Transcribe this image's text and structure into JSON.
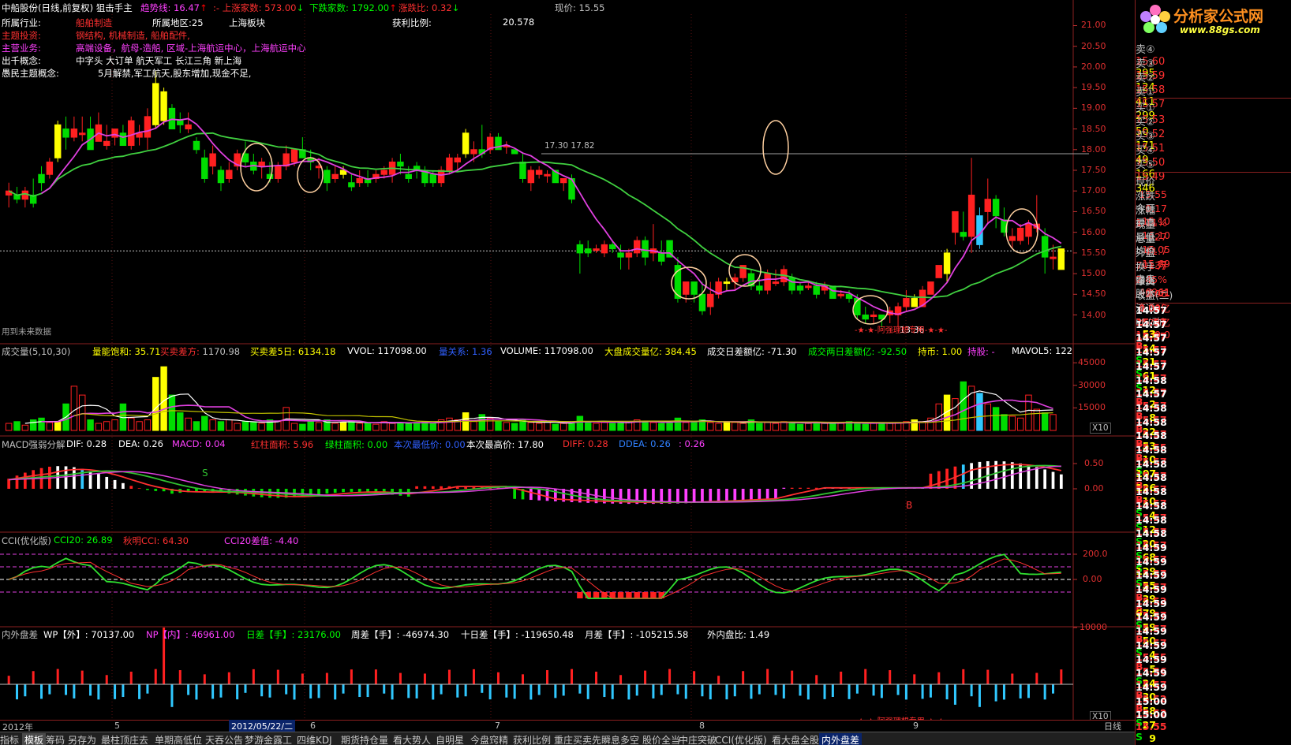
{
  "header": {
    "stock": "中船股份(日线,前复权) 狙击手主",
    "trend_label": "趋势线:",
    "trend_val": "16.47",
    "trend_arrow": "↑",
    "dash": ":-",
    "up_label": "上涨家数:",
    "up_val": "573.00",
    "up_arrow": "↓",
    "down_label": "下跌家数:",
    "down_val": "1792.00",
    "down_arrow": "↑",
    "ratio_label": "涨跌比:",
    "ratio_val": "0.32",
    "ratio_arrow": "↓",
    "price_label": "现价:",
    "price_val": "15.55"
  },
  "info": {
    "industry_label": "所属行业:",
    "industry": "船舶制造",
    "region_label": "所属地区:25",
    "sector": "上海板块",
    "theme_label": "主题投资:",
    "theme": "钢结构, 机械制造, 船舶配件,",
    "business_label": "主营业务:",
    "business": "高端设备，航母-造船, 区域-上海航运中心，上海航运中心",
    "concept_label": "出千概念:",
    "concept": "中字头 大订单 航天军工 长江三角 新上海",
    "folk_label": "愚民主题概念:",
    "folk": "5月解禁,军工航天,股东增加,现金不足,",
    "profit_label": "获利比例:",
    "profit_val": "20.578",
    "future_note": "用到未来数据",
    "p1730": "17.30",
    "p1782": "17.82",
    "mark1336": "13.36",
    "stars": "-★-★-阿强理想专用-★-★-"
  },
  "price_axis": {
    "ticks": [
      "21.00",
      "20.50",
      "20.00",
      "19.50",
      "19.00",
      "18.50",
      "18.00",
      "17.50",
      "17.00",
      "16.50",
      "16.00",
      "15.50",
      "15.00",
      "14.50",
      "14.00"
    ]
  },
  "vol_panel": {
    "title": "成交量(5,10,30)",
    "sat": "量能饱和: 35.71",
    "buy_label": "买卖差方:",
    "buy_val": "1170.98",
    "buy5": "买卖差5日: 6134.18",
    "vvol": "VVOL: 117098.00",
    "vol_label": "量关系: 1.36",
    "volume": "VOLUME: 117098.00",
    "big": "大盘成交量亿: 384.45",
    "diff_day": "成交日差额亿: -71.30",
    "diff_two": "成交两日差额亿: -92.50",
    "hold": "持币: 1.00",
    "holdstock": "持股: -",
    "mavol": "MAVOL5: 122",
    "ticks": [
      "45000",
      "30000",
      "15000"
    ],
    "x10": "X10"
  },
  "macd_panel": {
    "title": "MACD强弱分解",
    "dif": "DIF: 0.28",
    "dea": "DEA: 0.26",
    "macd": "MACD: 0.04",
    "red_area": "红柱面积: 5.96",
    "green_area": "绿柱面积: 0.00",
    "low_price": "本次最低价: 0.00",
    "high_price": "本次最高价: 17.80",
    "diff": "DIFF: 0.28",
    "ddea": "DDEA: 0.26",
    "last": ": 0.26",
    "ticks": [
      "0.50",
      "0.00"
    ],
    "s_mark": "S",
    "b_mark": "B"
  },
  "cci_panel": {
    "title": "CCI(优化版)",
    "cci20": "CCI20: 26.89",
    "autumn": "秋明CCI: 64.30",
    "diff": "CCI20差值: -4.40",
    "ticks": [
      "200.0",
      "0.00"
    ]
  },
  "wp_panel": {
    "title": "内外盘差",
    "wp": "WP【外】: 70137.00",
    "np": "NP【内】: 46961.00",
    "day": "日差【手】: 23176.00",
    "week": "周差【手】: -46974.30",
    "ten": "十日差【手】: -119650.48",
    "month": "月差【手】: -105215.58",
    "ratio": "外内盘比: 1.49",
    "ticks": [
      "10000"
    ],
    "x10": "X10",
    "stars": "-★-★-阿强理想专用-★-★-"
  },
  "date_axis": {
    "year": "2012年",
    "d5": "5",
    "selected": "2012/05/22/二",
    "d6": "6",
    "d7": "7",
    "d8": "8",
    "d9": "9",
    "period": "日线"
  },
  "tabs": [
    "指标",
    "模板",
    "筹码",
    "另存为",
    "最柱顶庄去",
    "单期高低位",
    "天吞公告",
    "梦游金露工",
    "四维KDJ",
    "期货持仓量",
    "看大势人",
    "自明星",
    "今盘窍精",
    "获利比例",
    "重庄买卖先",
    "瞬息多空",
    "股价全当",
    "中庄突破",
    "CCI(优化版)",
    "看大盘全股",
    "内外盘差"
  ],
  "logo": {
    "title": "分析家公式网",
    "url": "www.88gs.com"
  },
  "order_book": {
    "sell": [
      {
        "label": "卖⑤",
        "price": "15.60",
        "vol": "395"
      },
      {
        "label": "卖④",
        "price": "15.60",
        "vol": "395"
      },
      {
        "label": "卖③",
        "price": "15.59",
        "vol": "124"
      },
      {
        "label": "卖②",
        "price": "15.58",
        "vol": "411"
      },
      {
        "label": "卖①",
        "price": "15.57",
        "vol": "299"
      }
    ],
    "buy": [
      {
        "label": "买①",
        "price": "15.53",
        "vol": "50"
      },
      {
        "label": "买②",
        "price": "15.52",
        "vol": "171"
      },
      {
        "label": "买③",
        "price": "15.51",
        "vol": "49"
      },
      {
        "label": "买④",
        "price": "15.50",
        "vol": "166"
      },
      {
        "label": "买⑤",
        "price": "15.49",
        "vol": "346"
      }
    ]
  },
  "stats": [
    {
      "l1": "现价",
      "v1": "15.55",
      "l2": "今开",
      "v2": "15.10"
    },
    {
      "l1": "涨跌",
      "v1": "0.17",
      "l2": "最高",
      "v2": "16.10"
    },
    {
      "l1": "涨幅",
      "v1": "1.11%",
      "l2": "最低",
      "v2": "15.05"
    },
    {
      "l1": "现量",
      "v1": "27",
      "l2": "均价",
      "v2": "15.69"
    },
    {
      "l1": "总量",
      "v1": "11.7万",
      "l2": "量比",
      "v2": "1.01"
    },
    {
      "l1": "外盘",
      "v1": "70137",
      "l2": "内盘",
      "v2": "46961"
    },
    {
      "l1": "换手",
      "v1": "2.45%",
      "l2": "股本",
      "v2": "4.78亿"
    },
    {
      "l1": "净资",
      "v1": "2.96",
      "l2": "流通",
      "v2": "4.78亿"
    },
    {
      "l1": "收益(二)",
      "v1": "0.005",
      "l2": "PE(动)",
      "v2": "1539.0"
    }
  ],
  "ticks": [
    {
      "t": "14:57",
      "p": "15.57",
      "v": "53",
      "s": "B"
    },
    {
      "t": "14:57",
      "p": "15.57",
      "v": "14",
      "s": "S"
    },
    {
      "t": "14:57",
      "p": "15.57",
      "v": "21",
      "s": "S"
    },
    {
      "t": "14:57",
      "p": "15.57",
      "v": "61",
      "s": "S"
    },
    {
      "t": "14:57",
      "p": "15.57",
      "v": "12",
      "s": "B"
    },
    {
      "t": "14:58",
      "p": "15.57",
      "v": "2",
      "s": "B"
    },
    {
      "t": "14:57",
      "p": "15.57",
      "v": "8",
      "s": "B"
    },
    {
      "t": "14:58",
      "p": "15.57",
      "v": "22",
      "s": "B"
    },
    {
      "t": "14:58",
      "p": "15.57",
      "v": "53",
      "s": "B"
    },
    {
      "t": "14:58",
      "p": "15.55",
      "v": "10",
      "s": "S"
    },
    {
      "t": "14:58",
      "p": "15.57",
      "v": "107",
      "s": "B"
    },
    {
      "t": "14:58",
      "p": "15.57",
      "v": "126",
      "s": "B"
    },
    {
      "t": "14:58",
      "p": "15.57",
      "v": "10",
      "s": "S"
    },
    {
      "t": "14:58",
      "p": "15.57",
      "v": "4",
      "s": "S"
    },
    {
      "t": "14:58",
      "p": "15.57",
      "v": "12",
      "s": "S"
    },
    {
      "t": "14:58",
      "p": "15.57",
      "v": "20",
      "s": "S"
    },
    {
      "t": "14:58",
      "p": "15.57",
      "v": "68",
      "s": "S"
    },
    {
      "t": "14:59",
      "p": "15.57",
      "v": "129",
      "s": "S"
    },
    {
      "t": "14:59",
      "p": "15.57",
      "v": "55",
      "s": "B"
    },
    {
      "t": "14:59",
      "p": "15.57",
      "v": "39",
      "s": "B"
    },
    {
      "t": "14:59",
      "p": "15.52",
      "v": "679",
      "s": "S"
    },
    {
      "t": "14:59",
      "p": "15.57",
      "v": "59",
      "s": "B"
    },
    {
      "t": "14:59",
      "p": "15.57",
      "v": "50",
      "s": "S"
    },
    {
      "t": "14:59",
      "p": "15.57",
      "v": "4",
      "s": "B"
    },
    {
      "t": "14:59",
      "p": "15.55",
      "v": "5",
      "s": "S"
    },
    {
      "t": "14:59",
      "p": "15.56",
      "v": "24",
      "s": "B"
    },
    {
      "t": "14:59",
      "p": "15.57",
      "v": "30",
      "s": "B"
    },
    {
      "t": "14:59",
      "p": "15.52",
      "v": "58",
      "s": "S"
    },
    {
      "t": "15:00",
      "p": "15.52",
      "v": "27",
      "s": "S"
    },
    {
      "t": "15:00",
      "p": "15.55",
      "v": "9",
      "s": "B"
    }
  ],
  "chart_data": {
    "type": "candlestick",
    "price_ylim": [
      13.8,
      21.2
    ],
    "candles": [
      [
        16.9,
        17.2,
        16.6,
        17.0
      ],
      [
        16.9,
        17.1,
        16.7,
        16.8
      ],
      [
        16.8,
        17.1,
        16.6,
        17.0
      ],
      [
        16.9,
        17.3,
        16.6,
        16.7
      ],
      [
        17.4,
        17.6,
        17.0,
        17.2
      ],
      [
        17.4,
        17.8,
        17.3,
        17.7
      ],
      [
        17.8,
        18.7,
        17.7,
        18.6
      ],
      [
        18.5,
        18.8,
        18.0,
        18.3
      ],
      [
        18.3,
        18.8,
        18.2,
        18.5
      ],
      [
        18.4,
        18.8,
        18.2,
        18.4
      ],
      [
        18.5,
        18.8,
        18.0,
        18.0
      ],
      [
        18.2,
        18.9,
        18.2,
        18.6
      ],
      [
        18.1,
        18.6,
        18.0,
        18.2
      ],
      [
        18.3,
        18.5,
        18.1,
        18.5
      ],
      [
        18.4,
        18.6,
        18.1,
        18.1
      ],
      [
        18.1,
        18.8,
        18.0,
        18.7
      ],
      [
        18.3,
        18.6,
        18.1,
        18.4
      ],
      [
        18.3,
        19.0,
        18.0,
        18.8
      ],
      [
        19.6,
        19.9,
        18.5,
        18.6
      ],
      [
        18.7,
        19.5,
        18.6,
        19.4
      ],
      [
        19.0,
        19.1,
        18.5,
        18.5
      ],
      [
        18.7,
        18.9,
        18.4,
        18.6
      ],
      [
        18.5,
        18.9,
        18.4,
        18.6
      ],
      [
        18.2,
        18.3,
        17.9,
        18.0
      ],
      [
        17.8,
        18.0,
        17.2,
        17.3
      ],
      [
        17.6,
        18.1,
        17.4,
        17.9
      ],
      [
        17.5,
        17.6,
        17.0,
        17.2
      ],
      [
        17.3,
        17.7,
        17.2,
        17.5
      ],
      [
        17.6,
        18.0,
        17.5,
        17.9
      ],
      [
        17.9,
        18.2,
        17.6,
        17.7
      ],
      [
        17.7,
        17.9,
        17.4,
        17.5
      ],
      [
        17.6,
        17.8,
        17.3,
        17.7
      ],
      [
        17.4,
        17.7,
        17.2,
        17.3
      ],
      [
        17.3,
        17.7,
        17.2,
        17.6
      ],
      [
        17.6,
        18.1,
        17.5,
        17.9
      ],
      [
        17.7,
        18.0,
        17.6,
        18.0
      ],
      [
        18.0,
        18.3,
        17.8,
        17.8
      ],
      [
        17.8,
        18.0,
        17.5,
        17.7
      ],
      [
        17.6,
        17.8,
        17.3,
        17.6
      ],
      [
        17.5,
        17.6,
        17.0,
        17.2
      ],
      [
        17.3,
        17.6,
        17.2,
        17.4
      ],
      [
        17.4,
        17.6,
        17.3,
        17.5
      ],
      [
        17.2,
        17.4,
        17.0,
        17.1
      ],
      [
        17.2,
        17.5,
        17.1,
        17.3
      ],
      [
        17.3,
        17.5,
        17.1,
        17.2
      ],
      [
        17.3,
        17.5,
        17.2,
        17.4
      ],
      [
        17.4,
        17.6,
        17.3,
        17.5
      ],
      [
        17.4,
        17.8,
        17.2,
        17.7
      ],
      [
        17.7,
        17.9,
        17.4,
        17.6
      ],
      [
        17.4,
        17.6,
        17.2,
        17.3
      ],
      [
        17.6,
        17.7,
        17.3,
        17.5
      ],
      [
        17.5,
        17.6,
        17.1,
        17.2
      ],
      [
        17.4,
        17.5,
        17.1,
        17.2
      ],
      [
        17.2,
        17.6,
        17.1,
        17.5
      ],
      [
        17.5,
        17.9,
        17.4,
        17.8
      ],
      [
        17.7,
        17.9,
        17.5,
        17.8
      ],
      [
        17.9,
        18.5,
        17.8,
        18.4
      ],
      [
        17.9,
        18.2,
        17.7,
        18.0
      ],
      [
        18.0,
        18.6,
        17.8,
        17.9
      ],
      [
        18.0,
        18.4,
        17.9,
        18.3
      ],
      [
        18.3,
        18.4,
        18.0,
        18.0
      ],
      [
        18.1,
        18.2,
        17.9,
        18.1
      ],
      [
        18.0,
        18.0,
        17.9,
        17.9
      ],
      [
        17.7,
        17.9,
        17.2,
        17.3
      ],
      [
        17.2,
        17.6,
        17.0,
        17.5
      ],
      [
        17.4,
        17.6,
        17.3,
        17.5
      ],
      [
        17.4,
        17.5,
        17.2,
        17.4
      ],
      [
        17.5,
        17.5,
        17.2,
        17.2
      ],
      [
        17.2,
        17.3,
        17.0,
        17.3
      ],
      [
        17.3,
        17.4,
        16.7,
        16.8
      ],
      [
        15.7,
        15.8,
        15.0,
        15.5
      ],
      [
        15.6,
        15.8,
        15.4,
        15.5
      ],
      [
        15.6,
        15.7,
        15.5,
        15.6
      ],
      [
        15.5,
        15.8,
        15.4,
        15.7
      ],
      [
        15.7,
        15.8,
        15.5,
        15.6
      ],
      [
        15.5,
        15.7,
        15.1,
        15.4
      ],
      [
        15.4,
        15.6,
        15.1,
        15.5
      ],
      [
        15.5,
        15.9,
        15.4,
        15.8
      ],
      [
        15.8,
        15.9,
        15.2,
        15.4
      ],
      [
        15.5,
        16.2,
        15.3,
        15.6
      ],
      [
        15.5,
        15.8,
        15.2,
        15.3
      ],
      [
        15.8,
        15.8,
        15.4,
        15.4
      ],
      [
        15.2,
        15.4,
        14.3,
        14.4
      ],
      [
        14.5,
        14.8,
        14.3,
        14.8
      ],
      [
        14.8,
        14.8,
        14.3,
        14.5
      ],
      [
        14.5,
        14.8,
        14.0,
        14.1
      ],
      [
        14.2,
        14.8,
        14.0,
        14.5
      ],
      [
        14.5,
        14.9,
        14.4,
        14.8
      ],
      [
        14.8,
        14.9,
        14.6,
        14.8
      ],
      [
        14.8,
        15.0,
        14.6,
        14.9
      ],
      [
        14.9,
        15.2,
        14.8,
        15.2
      ],
      [
        15.0,
        15.1,
        14.6,
        14.7
      ],
      [
        14.7,
        14.9,
        14.5,
        14.6
      ],
      [
        14.6,
        15.1,
        14.5,
        15.0
      ],
      [
        14.8,
        15.1,
        14.7,
        14.8
      ],
      [
        14.8,
        15.2,
        14.7,
        15.1
      ],
      [
        14.9,
        15.0,
        14.5,
        14.6
      ],
      [
        14.7,
        14.8,
        14.5,
        14.6
      ],
      [
        14.7,
        14.8,
        14.6,
        14.7
      ],
      [
        14.7,
        14.8,
        14.4,
        14.5
      ],
      [
        14.6,
        14.8,
        14.5,
        14.7
      ],
      [
        14.7,
        14.7,
        14.4,
        14.4
      ],
      [
        14.5,
        14.6,
        14.4,
        14.5
      ],
      [
        14.5,
        14.6,
        14.3,
        14.4
      ],
      [
        14.4,
        14.5,
        13.9,
        14.0
      ],
      [
        14.0,
        14.2,
        13.8,
        13.9
      ],
      [
        14.0,
        14.1,
        13.8,
        14.0
      ],
      [
        14.0,
        14.0,
        13.7,
        13.9
      ],
      [
        14.0,
        14.2,
        13.8,
        14.1
      ],
      [
        14.0,
        14.3,
        13.7,
        14.2
      ],
      [
        14.2,
        14.6,
        14.1,
        14.4
      ],
      [
        14.4,
        14.5,
        14.2,
        14.2
      ],
      [
        14.2,
        14.7,
        14.2,
        14.6
      ],
      [
        14.5,
        14.8,
        14.5,
        14.8
      ],
      [
        14.9,
        15.2,
        14.9,
        15.2
      ],
      [
        15.0,
        15.6,
        14.8,
        15.5
      ],
      [
        16.0,
        16.3,
        15.7,
        16.5
      ],
      [
        16.0,
        16.5,
        15.8,
        15.9
      ],
      [
        15.9,
        17.8,
        15.5,
        16.9
      ],
      [
        16.4,
        16.6,
        15.6,
        15.7
      ],
      [
        16.5,
        17.3,
        16.2,
        16.8
      ],
      [
        16.8,
        16.9,
        16.1,
        16.4
      ],
      [
        16.3,
        16.6,
        15.9,
        16.0
      ],
      [
        15.8,
        16.1,
        15.6,
        15.9
      ],
      [
        15.8,
        16.2,
        15.7,
        16.1
      ],
      [
        15.9,
        16.3,
        15.7,
        16.2
      ],
      [
        16.1,
        16.9,
        16.0,
        16.2
      ],
      [
        15.9,
        16.1,
        15.0,
        15.4
      ],
      [
        15.4,
        15.7,
        15.1,
        15.4
      ],
      [
        15.6,
        15.6,
        15.2,
        15.1
      ]
    ],
    "series": [
      {
        "name": "趋势线",
        "values": []
      }
    ]
  }
}
